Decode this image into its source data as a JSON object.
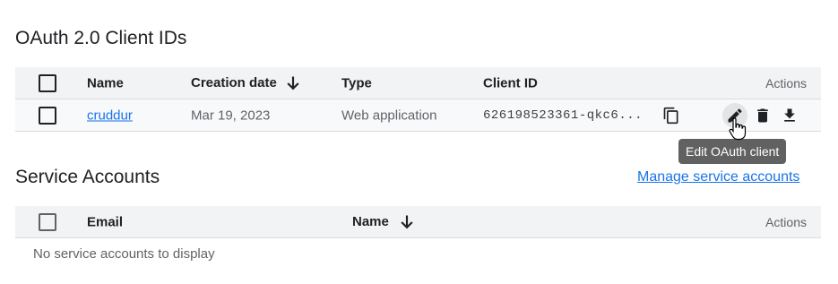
{
  "oauth_section": {
    "title": "OAuth 2.0 Client IDs",
    "columns": {
      "name": "Name",
      "creation_date": "Creation date",
      "type": "Type",
      "client_id": "Client ID",
      "actions": "Actions"
    },
    "rows": [
      {
        "name": "cruddur",
        "creation_date": "Mar 19, 2023",
        "type": "Web application",
        "client_id": "626198523361-qkc6..."
      }
    ],
    "sort_icon": "arrow-down-icon",
    "action_icons": [
      "copy-icon",
      "edit-icon",
      "delete-icon",
      "download-icon"
    ]
  },
  "tooltip": {
    "text": "Edit OAuth client"
  },
  "service_accounts_section": {
    "title": "Service Accounts",
    "manage_link": "Manage service accounts",
    "columns": {
      "email": "Email",
      "name": "Name",
      "actions": "Actions"
    },
    "empty_text": "No service accounts to display",
    "sort_icon": "arrow-down-icon"
  },
  "colors": {
    "link": "#1a73e8",
    "header_bg": "#f1f3f4",
    "row_bg": "#f8f9fa",
    "tooltip_bg": "#616161"
  }
}
